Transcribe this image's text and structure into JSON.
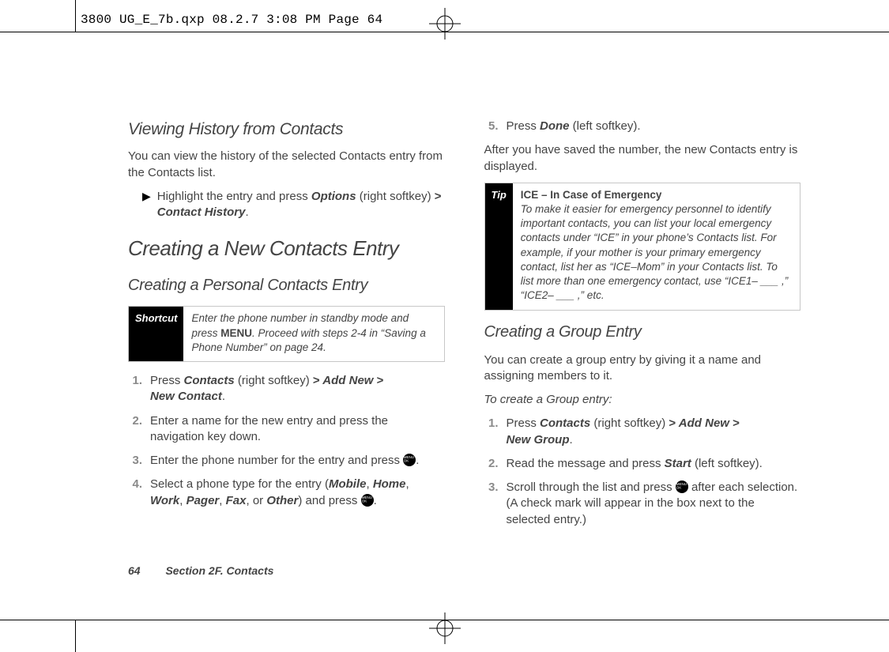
{
  "header_info": "3800 UG_E_7b.qxp  08.2.7  3:08 PM  Page 64",
  "left": {
    "topic": "Viewing History from Contacts",
    "topic_para": "You can view the history of the selected Contacts entry from the Contacts list.",
    "bullet_prefix": "Highlight the entry and press ",
    "bullet_opt": "Options",
    "bullet_mid": " (right softkey) ",
    "bullet_gt1": ">",
    "bullet_ch": "Contact History",
    "bullet_end": ".",
    "section": "Creating a New Contacts Entry",
    "sub": "Creating a Personal Contacts Entry",
    "shortcut_tag": "Shortcut",
    "shortcut_body_pre": "Enter the phone number in standby mode and press ",
    "shortcut_body_menu": "MENU",
    "shortcut_body_post": ". Proceed with steps 2-4 in “Saving a Phone Number” on page 24.",
    "s1_n": "1.",
    "s1_a": "Press ",
    "s1_contacts": "Contacts",
    "s1_b": " (right softkey) ",
    "s1_gt1": ">",
    "s1_addnew": " Add New ",
    "s1_gt2": ">",
    "s1_nc": "New Contact",
    "s1_end": ".",
    "s2_n": "2.",
    "s2_t": "Enter a name for the new entry and press the navigation key down.",
    "s3_n": "3.",
    "s3_a": "Enter the phone number for the entry and press ",
    "s3_end": ".",
    "s4_n": "4.",
    "s4_a": "Select a phone type for the entry (",
    "s4_mobile": "Mobile",
    "s4_c1": ", ",
    "s4_home": "Home",
    "s4_c2": ", ",
    "s4_work": "Work",
    "s4_c3": ", ",
    "s4_pager": "Pager",
    "s4_c4": ", ",
    "s4_fax": "Fax",
    "s4_c5": ", or ",
    "s4_other": "Other",
    "s4_b": ") and press ",
    "s4_end": "."
  },
  "right": {
    "s5_n": "5.",
    "s5_a": "Press ",
    "s5_done": "Done",
    "s5_b": " (left softkey).",
    "after_para": "After you have saved the number, the new Contacts entry is displayed.",
    "tip_tag": "Tip",
    "tip_title": "ICE – In Case of Emergency",
    "tip_body": "To make it easier for emergency personnel to identify important contacts, you can list your local emergency contacts under “ICE” in your phone’s Contacts list. For example, if your mother is your primary emergency contact, list her as “ICE–Mom” in your Contacts list. To list more than one emergency contact, use “ICE1– ___ ,” “ICE2– ___ ,” etc.",
    "group_h": "Creating a Group Entry",
    "group_p": "You can create a group entry by giving it a name and assigning members to it.",
    "group_lead": "To create a Group entry:",
    "g1_n": "1.",
    "g1_a": "Press ",
    "g1_contacts": "Contacts",
    "g1_b": " (right softkey) ",
    "g1_gt1": ">",
    "g1_addnew": " Add New ",
    "g1_gt2": ">",
    "g1_ng": "New Group",
    "g1_end": ".",
    "g2_n": "2.",
    "g2_a": "Read the message and press ",
    "g2_start": "Start",
    "g2_b": " (left softkey).",
    "g3_n": "3.",
    "g3_a": "Scroll through the list and press ",
    "g3_b": " after each selection. (A check mark will appear in the box next to the selected entry.)"
  },
  "footer": {
    "page": "64",
    "section": "Section 2F. Contacts"
  },
  "icon_text": "MENU OK"
}
